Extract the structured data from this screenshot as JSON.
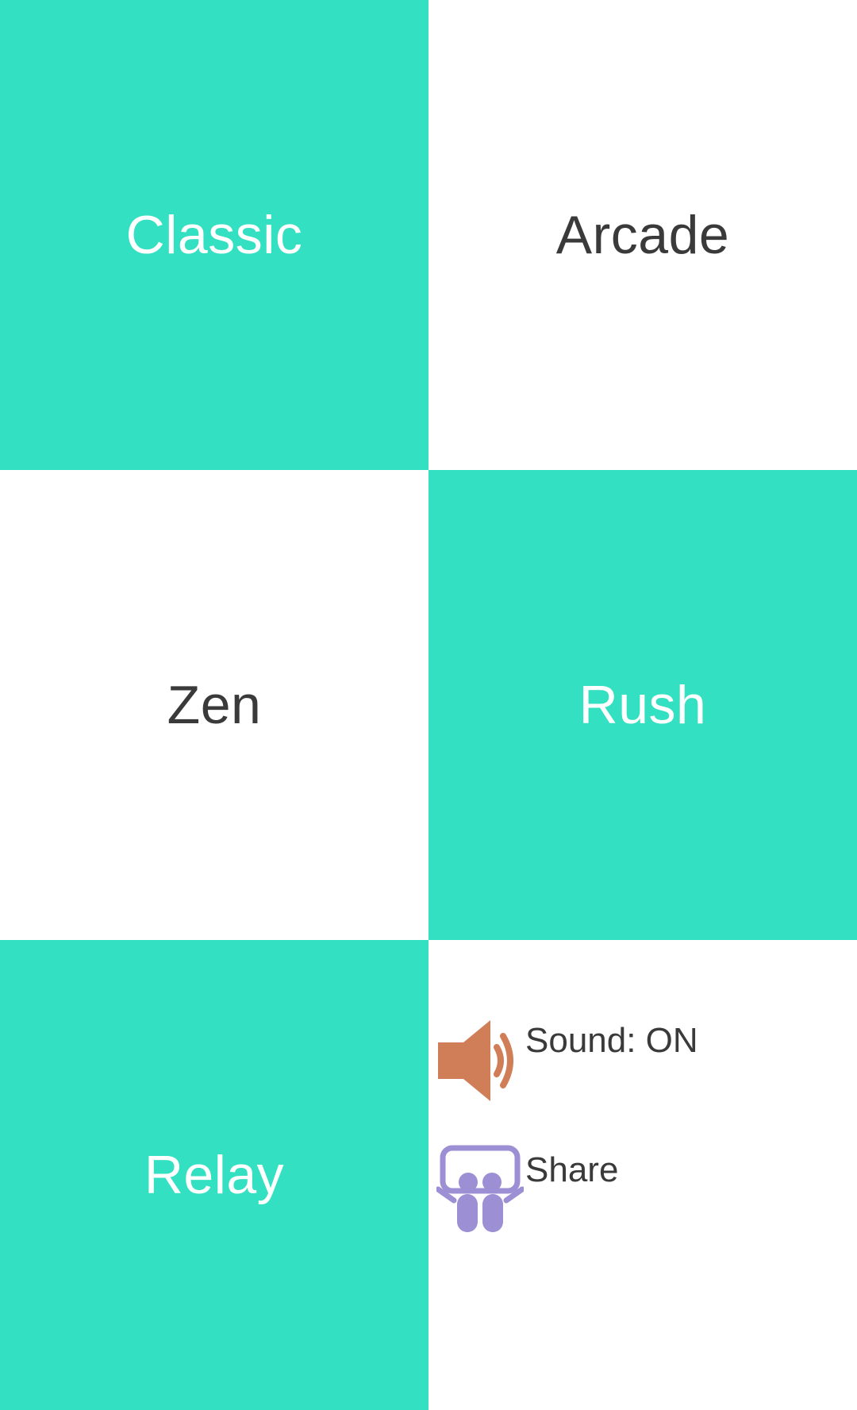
{
  "modes": {
    "classic": {
      "label": "Classic"
    },
    "arcade": {
      "label": "Arcade"
    },
    "zen": {
      "label": "Zen"
    },
    "rush": {
      "label": "Rush"
    },
    "relay": {
      "label": "Relay"
    }
  },
  "options": {
    "sound": {
      "label": "Sound: ON",
      "icon": "speaker-icon",
      "color": "#D07E57"
    },
    "share": {
      "label": "Share",
      "icon": "share-icon",
      "color": "#9D8FD3"
    }
  },
  "colors": {
    "accent": "#33E0C1",
    "tile_white": "#FFFFFF",
    "dark_text": "#3A3A3A"
  }
}
